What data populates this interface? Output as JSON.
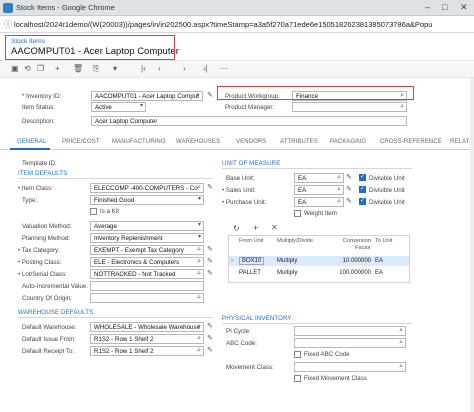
{
  "browser": {
    "title": "Stock Items - Google Chrome",
    "url": "localhost/2024r1demo/(W(20003))/pages/in/in202500.aspx?timeStamp=a3a5f270a71ede6e150518262381385073786a&Popu"
  },
  "header": {
    "breadcrumb": "Stock Items",
    "title": "AACOMPUT01 - Acer Laptop Computer"
  },
  "form": {
    "inventory_id_label": "Inventory ID:",
    "inventory_id": "AACOMPUT01 - Acer Laptop Comput",
    "item_status_label": "Item Status:",
    "item_status": "Active",
    "description_label": "Description:",
    "description": "Acer Laptop Computer",
    "product_workgroup_label": "Product Workgroup:",
    "product_workgroup": "Finance",
    "product_manager_label": "Product Manager:",
    "product_manager": ""
  },
  "tabs": [
    "GENERAL",
    "PRICE/COST",
    "MANUFACTURING",
    "WAREHOUSES",
    "VENDORS",
    "ATTRIBUTES",
    "PACKAGING",
    "CROSS-REFERENCE",
    "RELATE"
  ],
  "general": {
    "template_id_label": "Template ID:",
    "item_defaults_title": "ITEM DEFAULTS",
    "item_class_label": "Item Class:",
    "item_class": "ELECCOMP -400-COMPUTERS - Co",
    "type_label": "Type:",
    "type": "Finished Good",
    "is_kit_label": "Is a Kit",
    "valuation_label": "Valuation Method:",
    "valuation": "Average",
    "planning_label": "Planning Method:",
    "planning": "Inventory Replenishment",
    "tax_label": "Tax Category:",
    "tax": "EXEMPT - Exempt Tax Category",
    "posting_label": "Posting Class:",
    "posting": "ELE - Electronics & Computers",
    "lot_label": "Lot/Serial Class:",
    "lot": "NOTTRACKED - Not Tracked",
    "auto_inc_label": "Auto-Incremental Value:",
    "country_label": "Country Of Origin:",
    "warehouse_defaults_title": "WAREHOUSE DEFAULTS",
    "def_wh_label": "Default Warehouse:",
    "def_wh": "WHOLESALE - Wholesale Warehouse",
    "def_issue_label": "Default Issue From:",
    "def_issue": "R1S2 - Row 1 Shelf 2",
    "def_receipt_label": "Default Receipt To:",
    "def_receipt": "R1S2 - Row 1 Shelf 2"
  },
  "uom": {
    "title": "UNIT OF MEASURE",
    "base_label": "Base Unit:",
    "base": "EA",
    "sales_label": "Sales Unit:",
    "sales": "EA",
    "purchase_label": "Purchase Unit:",
    "purchase": "EA",
    "divisible_label": "Divisible Unit",
    "weight_label": "Weight Item",
    "grid_headers": [
      "From Unit",
      "Multiply/Divide",
      "Conversion Factor",
      "To Unit"
    ],
    "rows": [
      {
        "from": "BOX10",
        "op": "Multiply",
        "factor": "10.000000",
        "to": "EA"
      },
      {
        "from": "PALLET",
        "op": "Multiply",
        "factor": "100.000000",
        "to": "EA"
      }
    ]
  },
  "physical": {
    "title": "PHYSICAL INVENTORY",
    "pi_label": "PI Cycle:",
    "abc_label": "ABC Code:",
    "fixed_abc_label": "Fixed ABC Code",
    "movement_label": "Movement Class:",
    "fixed_movement_label": "Fixed Movement Class"
  },
  "colors": {
    "accent": "#1e6ec7",
    "highlight": "#e23a3a"
  }
}
